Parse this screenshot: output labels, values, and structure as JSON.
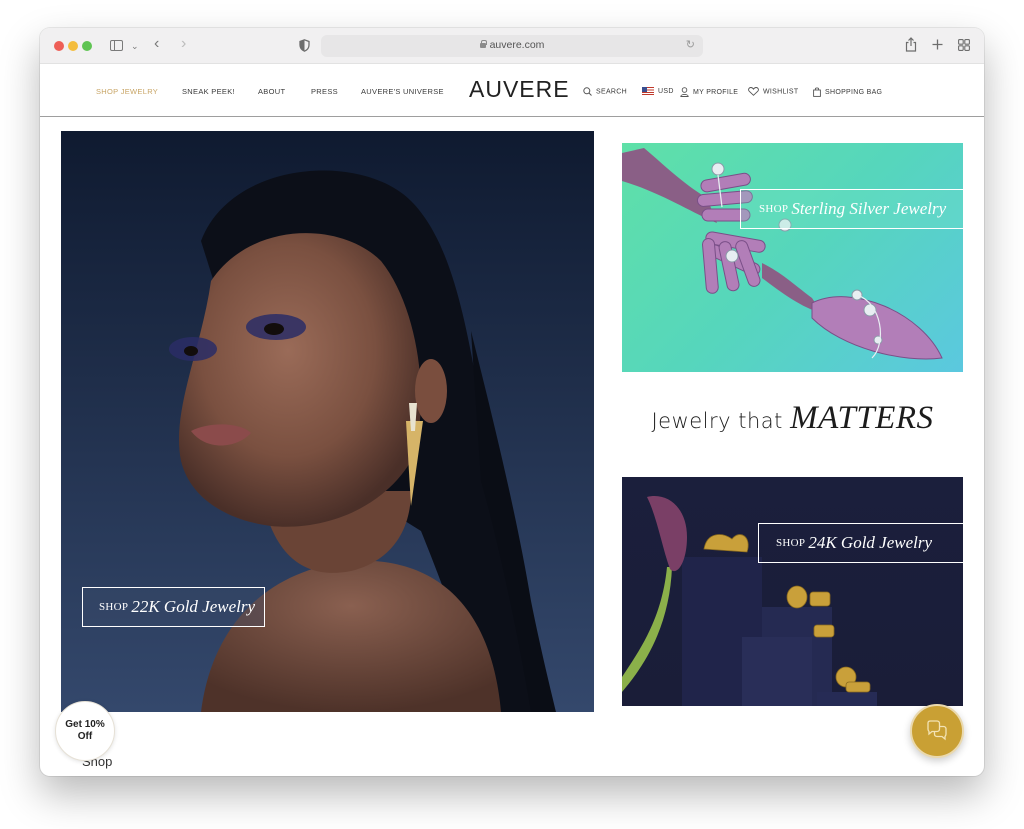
{
  "browser": {
    "url": "auvere.com",
    "buttons": {
      "back": "back",
      "forward": "forward",
      "share": "share",
      "new_tab": "new-tab",
      "tab_overview": "tab-overview"
    }
  },
  "header": {
    "logo": "AUVERE",
    "nav": [
      {
        "label": "SHOP JEWELRY",
        "active": true
      },
      {
        "label": "SNEAK PEEK!",
        "active": false
      },
      {
        "label": "ABOUT",
        "active": false
      },
      {
        "label": "PRESS",
        "active": false
      },
      {
        "label": "AUVERE'S UNIVERSE",
        "active": false
      }
    ],
    "utilities": {
      "search": "SEARCH",
      "currency": "USD",
      "profile": "MY PROFILE",
      "wishlist": "WISHLIST",
      "bag": "SHOPPING BAG"
    }
  },
  "hero": {
    "cta_prefix": "SHOP",
    "cta_name": "22K Gold Jewelry"
  },
  "cards": {
    "silver": {
      "cta_prefix": "SHOP",
      "cta_name": "Sterling Silver Jewelry"
    },
    "gold": {
      "cta_prefix": "SHOP",
      "cta_name": "24K Gold Jewelry"
    }
  },
  "tagline": {
    "plain": "Jewelry that ",
    "emphasis": "MATTERS"
  },
  "promo": {
    "line1": "Get 10%",
    "line2": "Off"
  },
  "footer_link": "Shop",
  "colors": {
    "accent_gold": "#c8a566",
    "chat_gold": "#c9a034",
    "hero_navy": "#1b2842",
    "silver_teal": "#56d6bc",
    "gold_card_navy": "#1b1f3c"
  }
}
